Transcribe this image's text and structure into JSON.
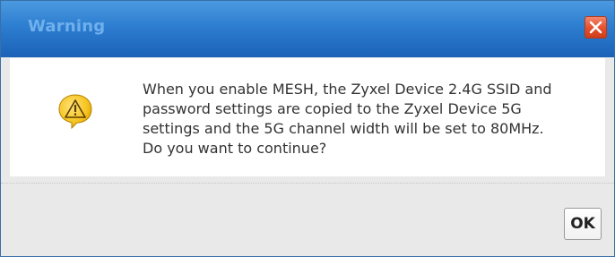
{
  "dialog": {
    "title": "Warning",
    "message_lines": [
      "When you enable MESH, the Zyxel Device 2.4G SSID and",
      "password settings are copied to the Zyxel Device 5G",
      "settings and the 5G channel width will be set to 80MHz.",
      "Do you want to continue?"
    ],
    "ok_label": "OK",
    "icons": {
      "close": "close-icon",
      "warning": "warning-icon"
    },
    "colors": {
      "titlebar": "#2d7dd0",
      "title_text": "#6fb0ec",
      "close_button": "#e5532f",
      "warning_fill": "#f6c21c"
    }
  }
}
